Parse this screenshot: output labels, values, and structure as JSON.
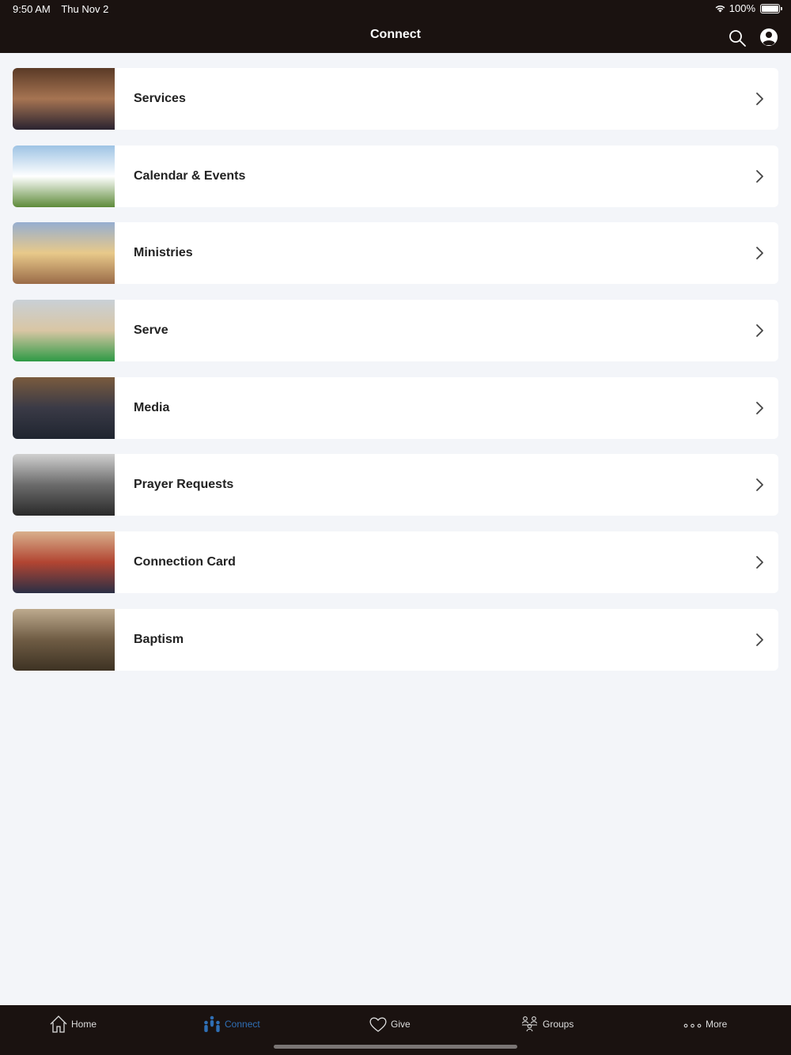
{
  "status": {
    "time": "9:50 AM",
    "date": "Thu Nov 2",
    "battery": "100%"
  },
  "nav": {
    "title": "Connect",
    "search_icon": "search-icon",
    "profile_icon": "profile-icon"
  },
  "items": [
    {
      "label": "Services",
      "thumb_colors": [
        "#5a3a26",
        "#a67452",
        "#2a2330"
      ]
    },
    {
      "label": "Calendar & Events",
      "thumb_colors": [
        "#9ec3e4",
        "#ffffff",
        "#5e8a3a"
      ]
    },
    {
      "label": "Ministries",
      "thumb_colors": [
        "#96aed0",
        "#e8c98a",
        "#9a6b48"
      ]
    },
    {
      "label": "Serve",
      "thumb_colors": [
        "#c9d0d6",
        "#d9c6a4",
        "#2e9a45"
      ]
    },
    {
      "label": "Media",
      "thumb_colors": [
        "#7a5b3e",
        "#3a3a46",
        "#1f2530"
      ]
    },
    {
      "label": "Prayer Requests",
      "thumb_colors": [
        "#d0d0d0",
        "#6b6b6b",
        "#2a2a2a"
      ]
    },
    {
      "label": "Connection Card",
      "thumb_colors": [
        "#d9b08c",
        "#b24532",
        "#2a2f45"
      ]
    },
    {
      "label": "Baptism",
      "thumb_colors": [
        "#bdaa8e",
        "#6f5c44",
        "#3d3223"
      ]
    }
  ],
  "tabs": [
    {
      "label": "Home",
      "icon": "home-icon"
    },
    {
      "label": "Connect",
      "icon": "people-icon"
    },
    {
      "label": "Give",
      "icon": "heart-icon"
    },
    {
      "label": "Groups",
      "icon": "groups-icon"
    },
    {
      "label": "More",
      "icon": "more-dots-icon"
    }
  ],
  "colors": {
    "nav_bg": "#1a1210",
    "page_bg": "#f3f5f9",
    "active_tab": "#2f6fb5"
  }
}
